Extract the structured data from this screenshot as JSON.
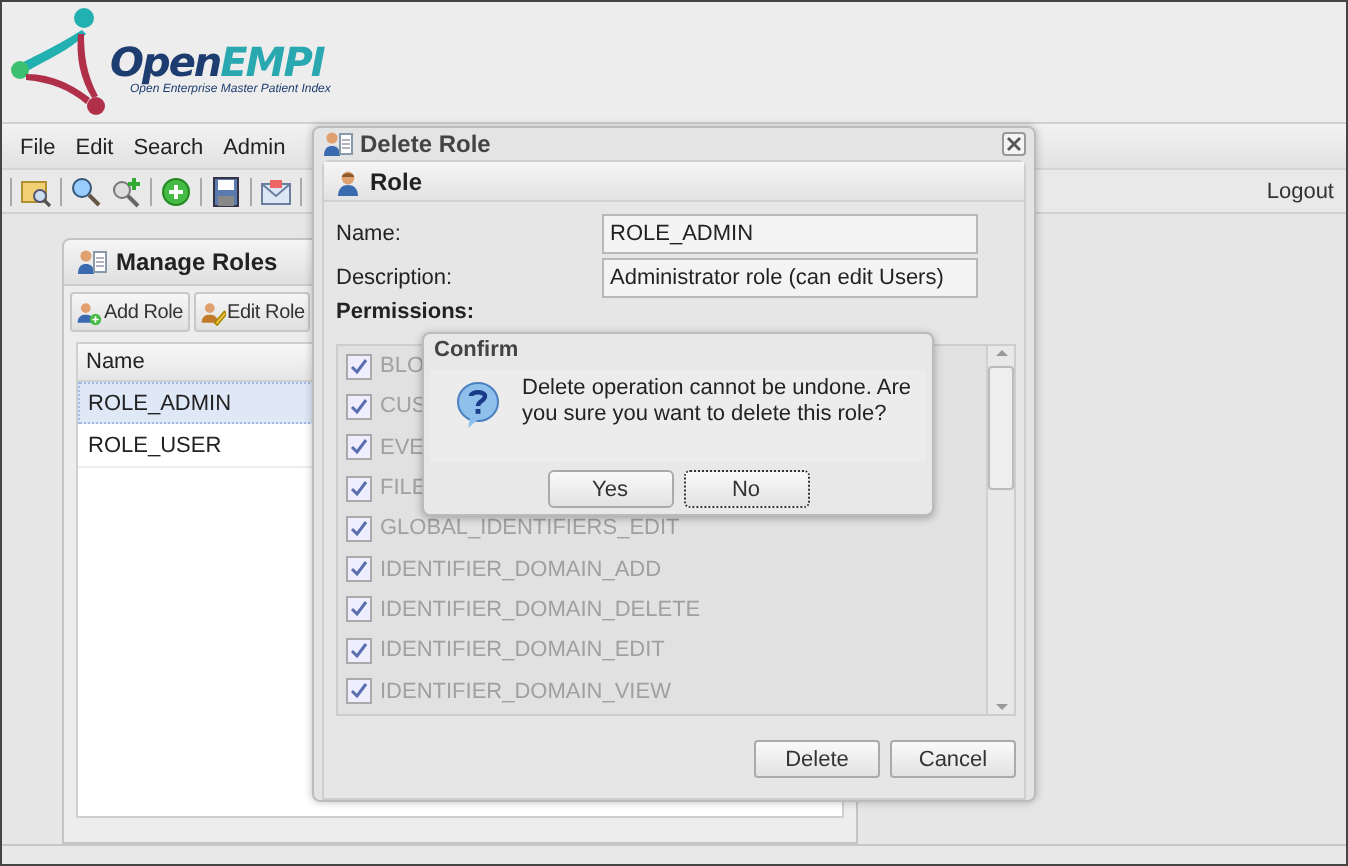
{
  "logo": {
    "parts": [
      "Open",
      "EMPI"
    ],
    "tagline": "Open Enterprise Master Patient Index"
  },
  "menu": [
    "File",
    "Edit",
    "Search",
    "Admin"
  ],
  "toolbar": {
    "logout": "Logout"
  },
  "manage_roles": {
    "title": "Manage Roles",
    "buttons": [
      "Add Role",
      "Edit Role"
    ],
    "columns": [
      "Name"
    ],
    "rows": [
      {
        "name": "ROLE_ADMIN",
        "selected": true
      },
      {
        "name": "ROLE_USER",
        "selected": false
      }
    ]
  },
  "delete_role": {
    "title": "Delete Role",
    "section": "Role",
    "fields": [
      {
        "label": "Name:",
        "value": "ROLE_ADMIN"
      },
      {
        "label": "Description:",
        "value": "Administrator role (can edit Users)"
      }
    ],
    "permissions_label": "Permissions:",
    "permissions": [
      {
        "label": "BLO",
        "checked": true
      },
      {
        "label": "CUS",
        "checked": true
      },
      {
        "label": "EVE",
        "checked": true
      },
      {
        "label": "FILE",
        "checked": true
      },
      {
        "label": "GLOBAL_IDENTIFIERS_EDIT",
        "checked": true
      },
      {
        "label": "IDENTIFIER_DOMAIN_ADD",
        "checked": true
      },
      {
        "label": "IDENTIFIER_DOMAIN_DELETE",
        "checked": true
      },
      {
        "label": "IDENTIFIER_DOMAIN_EDIT",
        "checked": true
      },
      {
        "label": "IDENTIFIER_DOMAIN_VIEW",
        "checked": true
      }
    ],
    "buttons": [
      "Delete",
      "Cancel"
    ]
  },
  "confirm": {
    "title": "Confirm",
    "message": "Delete operation cannot be undone. Are you sure you want to delete this role?",
    "buttons": [
      {
        "label": "Yes",
        "focused": false
      },
      {
        "label": "No",
        "focused": true
      }
    ]
  }
}
